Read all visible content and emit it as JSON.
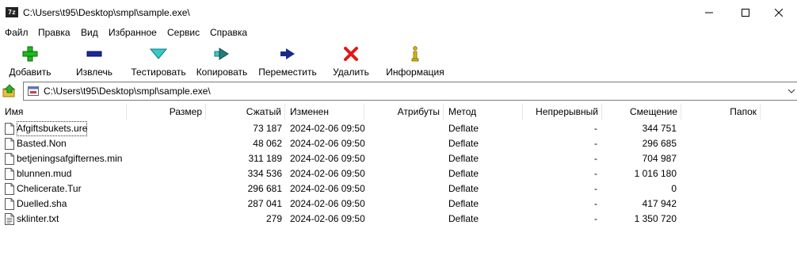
{
  "titlebar": {
    "app_icon_text": "7z",
    "path": "C:\\Users\\t95\\Desktop\\smpl\\sample.exe\\"
  },
  "menu": [
    "Файл",
    "Правка",
    "Вид",
    "Избранное",
    "Сервис",
    "Справка"
  ],
  "toolbar": {
    "add": "Добавить",
    "extract": "Извлечь",
    "test": "Тестировать",
    "copy": "Копировать",
    "move": "Переместить",
    "delete": "Удалить",
    "info": "Информация"
  },
  "address": {
    "path": "C:\\Users\\t95\\Desktop\\smpl\\sample.exe\\"
  },
  "columns": {
    "name": "Имя",
    "size": "Размер",
    "packed": "Сжатый",
    "modified": "Изменен",
    "attributes": "Атрибуты",
    "method": "Метод",
    "solid": "Непрерывный",
    "offset": "Смещение",
    "folders": "Папок"
  },
  "files": [
    {
      "name": "Afgiftsbukets.ure",
      "size": "",
      "packed": "73 187",
      "modified": "2024-02-06 09:50",
      "attributes": "",
      "method": "Deflate",
      "solid": "-",
      "offset": "344 751",
      "folders": ""
    },
    {
      "name": "Basted.Non",
      "size": "",
      "packed": "48 062",
      "modified": "2024-02-06 09:50",
      "attributes": "",
      "method": "Deflate",
      "solid": "-",
      "offset": "296 685",
      "folders": ""
    },
    {
      "name": "betjeningsafgifternes.min",
      "size": "",
      "packed": "311 189",
      "modified": "2024-02-06 09:50",
      "attributes": "",
      "method": "Deflate",
      "solid": "-",
      "offset": "704 987",
      "folders": ""
    },
    {
      "name": "blunnen.mud",
      "size": "",
      "packed": "334 536",
      "modified": "2024-02-06 09:50",
      "attributes": "",
      "method": "Deflate",
      "solid": "-",
      "offset": "1 016 180",
      "folders": ""
    },
    {
      "name": "Chelicerate.Tur",
      "size": "",
      "packed": "296 681",
      "modified": "2024-02-06 09:50",
      "attributes": "",
      "method": "Deflate",
      "solid": "-",
      "offset": "0",
      "folders": ""
    },
    {
      "name": "Duelled.sha",
      "size": "",
      "packed": "287 041",
      "modified": "2024-02-06 09:50",
      "attributes": "",
      "method": "Deflate",
      "solid": "-",
      "offset": "417 942",
      "folders": ""
    },
    {
      "name": "sklinter.txt",
      "size": "",
      "packed": "279",
      "modified": "2024-02-06 09:50",
      "attributes": "",
      "method": "Deflate",
      "solid": "-",
      "offset": "1 350 720",
      "folders": ""
    }
  ],
  "icons": {
    "add": "plus-icon",
    "extract": "minus-icon",
    "test": "check-arrow-icon",
    "copy": "copy-arrow-icon",
    "move": "move-arrow-icon",
    "delete": "x-icon",
    "info": "info-icon"
  },
  "colors": {
    "add": "#1fb81f",
    "extract": "#1a2a9a",
    "test": "#35c9c9",
    "copy": "#2a7a7a",
    "move": "#1a2a8a",
    "delete": "#e01818",
    "info": "#d8b800"
  }
}
